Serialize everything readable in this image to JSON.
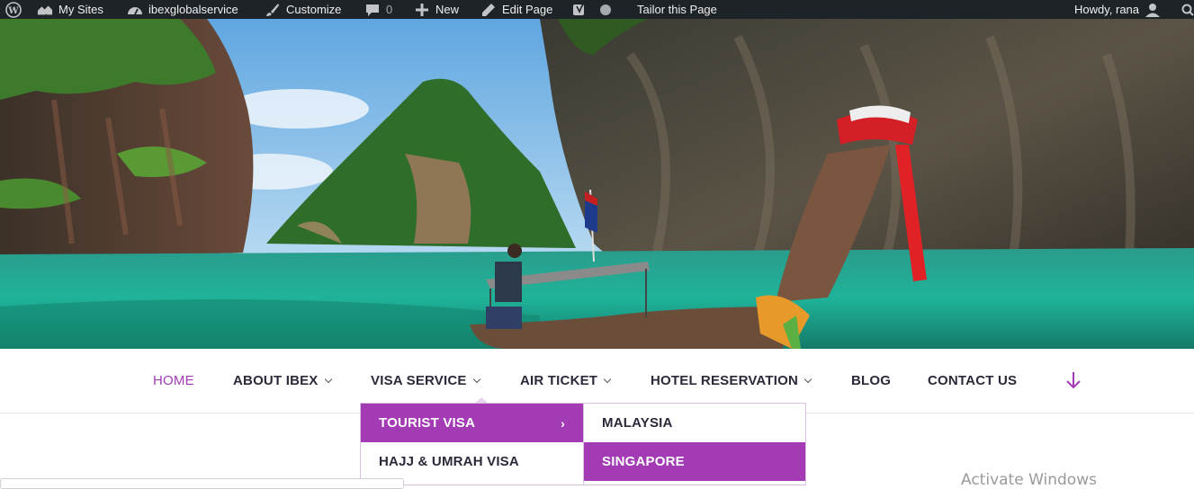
{
  "admin_bar": {
    "my_sites": "My Sites",
    "site_name": "ibexglobalservice",
    "customize": "Customize",
    "comments_count": "0",
    "new": "New",
    "edit_page": "Edit Page",
    "tailor": "Tailor this Page",
    "howdy": "Howdy, rana"
  },
  "nav": {
    "items": [
      {
        "label": "HOME",
        "active": true
      },
      {
        "label": "ABOUT IBEX",
        "has_submenu": true
      },
      {
        "label": "VISA SERVICE",
        "has_submenu": true
      },
      {
        "label": "AIR TICKET",
        "has_submenu": true
      },
      {
        "label": "HOTEL RESERVATION",
        "has_submenu": true
      },
      {
        "label": "BLOG"
      },
      {
        "label": "CONTACT US"
      }
    ]
  },
  "visa_dropdown": {
    "items": [
      {
        "label": "TOURIST VISA",
        "highlighted": true,
        "has_submenu": true
      },
      {
        "label": "HAJJ & UMRAH VISA"
      }
    ]
  },
  "tourist_dropdown": {
    "items": [
      {
        "label": "MALAYSIA"
      },
      {
        "label": "SINGAPORE",
        "highlighted": true
      }
    ]
  },
  "watermark": "Activate Windows",
  "colors": {
    "accent": "#a23bb4",
    "admin_bar": "#1d2327"
  }
}
